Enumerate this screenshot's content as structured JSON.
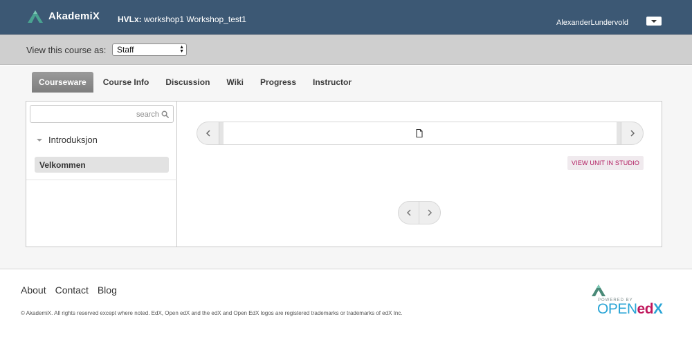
{
  "header": {
    "logo_text": "AkademiX",
    "course_org": "HVLx:",
    "course_name": "workshop1 Workshop_test1",
    "username": "AlexanderLundervold",
    "colors": {
      "background": "#3c5874",
      "logo_mark": "#4aa391"
    }
  },
  "view_as": {
    "label": "View this course as:",
    "selected": "Staff"
  },
  "tabs": [
    {
      "label": "Courseware",
      "active": true
    },
    {
      "label": "Course Info"
    },
    {
      "label": "Discussion"
    },
    {
      "label": "Wiki"
    },
    {
      "label": "Progress"
    },
    {
      "label": "Instructor"
    }
  ],
  "sidebar": {
    "search_placeholder": "search",
    "chapter": "Introduksjon",
    "section": "Velkommen"
  },
  "content": {
    "studio_button": "VIEW UNIT IN STUDIO",
    "accent": "#b0185e"
  },
  "footer": {
    "links": [
      "About",
      "Contact",
      "Blog"
    ],
    "copyright": "© AkademiX. All rights reserved except where noted. EdX, Open edX and the edX and Open EdX logos are registered trademarks or trademarks of edX Inc.",
    "powered_by": "POWERED BY",
    "openedx_open": "OPEN",
    "openedx_ed": "ed",
    "openedx_x": "X"
  }
}
